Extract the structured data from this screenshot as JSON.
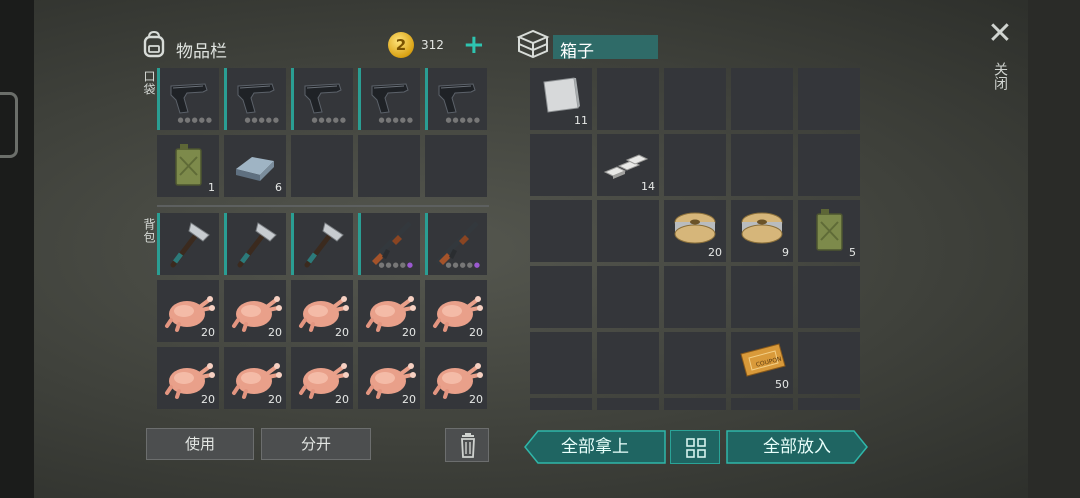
{
  "inventory": {
    "title": "物品栏",
    "coins": "312",
    "add_label": "+",
    "pocket_label": "口袋",
    "backpack_label": "背包",
    "pocket_slots": [
      {
        "item": "pistol-icon",
        "count": ""
      },
      {
        "item": "pistol-icon",
        "count": ""
      },
      {
        "item": "pistol-icon",
        "count": ""
      },
      {
        "item": "pistol-icon",
        "count": ""
      },
      {
        "item": "pistol-icon",
        "count": ""
      },
      {
        "item": "jerrycan-icon",
        "count": "1"
      },
      {
        "item": "metal-ingot-icon",
        "count": "6"
      },
      {
        "item": "",
        "count": ""
      },
      {
        "item": "",
        "count": ""
      },
      {
        "item": "",
        "count": ""
      }
    ],
    "backpack_slots": [
      {
        "item": "hatchet-icon",
        "count": ""
      },
      {
        "item": "hatchet-icon",
        "count": ""
      },
      {
        "item": "hatchet-icon",
        "count": ""
      },
      {
        "item": "assault-rifle-icon",
        "count": ""
      },
      {
        "item": "assault-rifle-icon",
        "count": ""
      },
      {
        "item": "raw-chicken-icon",
        "count": "20"
      },
      {
        "item": "raw-chicken-icon",
        "count": "20"
      },
      {
        "item": "raw-chicken-icon",
        "count": "20"
      },
      {
        "item": "raw-chicken-icon",
        "count": "20"
      },
      {
        "item": "raw-chicken-icon",
        "count": "20"
      },
      {
        "item": "raw-chicken-icon",
        "count": "20"
      },
      {
        "item": "raw-chicken-icon",
        "count": "20"
      },
      {
        "item": "raw-chicken-icon",
        "count": "20"
      },
      {
        "item": "raw-chicken-icon",
        "count": "20"
      },
      {
        "item": "raw-chicken-icon",
        "count": "20"
      }
    ],
    "use_button": "使用",
    "split_button": "分开"
  },
  "box": {
    "title": "箱子",
    "slots": [
      {
        "item": "metal-sheet-icon",
        "count": "11"
      },
      {
        "item": "",
        "count": ""
      },
      {
        "item": "",
        "count": ""
      },
      {
        "item": "",
        "count": ""
      },
      {
        "item": "",
        "count": ""
      },
      {
        "item": "",
        "count": ""
      },
      {
        "item": "metal-bars-icon",
        "count": "14"
      },
      {
        "item": "",
        "count": ""
      },
      {
        "item": "",
        "count": ""
      },
      {
        "item": "",
        "count": ""
      },
      {
        "item": "",
        "count": ""
      },
      {
        "item": "",
        "count": ""
      },
      {
        "item": "wire-spool-icon",
        "count": "20"
      },
      {
        "item": "wire-spool-icon",
        "count": "9"
      },
      {
        "item": "jerrycan-icon",
        "count": "5"
      },
      {
        "item": "",
        "count": ""
      },
      {
        "item": "",
        "count": ""
      },
      {
        "item": "",
        "count": ""
      },
      {
        "item": "",
        "count": ""
      },
      {
        "item": "",
        "count": ""
      },
      {
        "item": "",
        "count": ""
      },
      {
        "item": "",
        "count": ""
      },
      {
        "item": "",
        "count": ""
      },
      {
        "item": "coupon-icon",
        "count": "50"
      },
      {
        "item": "",
        "count": ""
      }
    ],
    "take_all_button": "全部拿上",
    "put_all_button": "全部放入"
  },
  "close_label": "关闭",
  "colors": {
    "accent": "#2a9e93",
    "slot": "#34363a",
    "rarity_purple": "#9b59d0"
  }
}
